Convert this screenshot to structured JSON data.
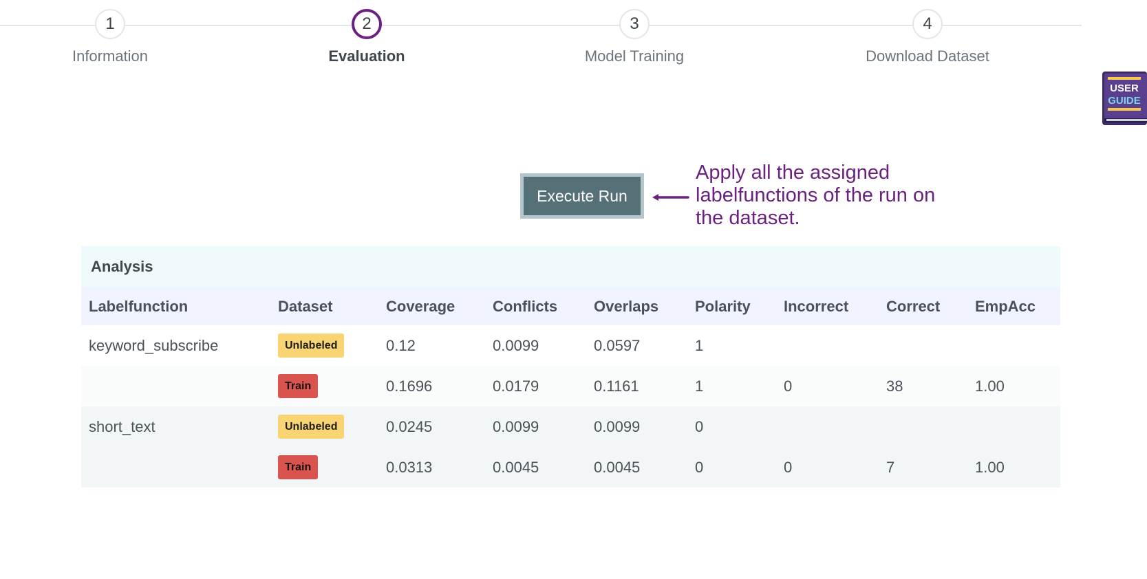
{
  "stepper": {
    "steps": [
      {
        "number": "1",
        "label": "Information"
      },
      {
        "number": "2",
        "label": "Evaluation"
      },
      {
        "number": "3",
        "label": "Model Training"
      },
      {
        "number": "4",
        "label": "Download Dataset"
      }
    ],
    "active_step": 2
  },
  "user_guide": {
    "line1": "USER",
    "line2": "GUIDE"
  },
  "execute": {
    "button_label": "Execute Run",
    "hint": "Apply all the assigned labelfunctions of the run on the dataset."
  },
  "analysis": {
    "title": "Analysis",
    "columns": [
      "Labelfunction",
      "Dataset",
      "Coverage",
      "Conflicts",
      "Overlaps",
      "Polarity",
      "Incorrect",
      "Correct",
      "EmpAcc"
    ],
    "rows": [
      {
        "labelfunction": "keyword_subscribe",
        "dataset": "Unlabeled",
        "coverage": "0.12",
        "conflicts": "0.0099",
        "overlaps": "0.0597",
        "polarity": "1",
        "incorrect": "",
        "correct": "",
        "empacc": ""
      },
      {
        "labelfunction": "",
        "dataset": "Train",
        "coverage": "0.1696",
        "conflicts": "0.0179",
        "overlaps": "0.1161",
        "polarity": "1",
        "incorrect": "0",
        "correct": "38",
        "empacc": "1.00"
      },
      {
        "labelfunction": "short_text",
        "dataset": "Unlabeled",
        "coverage": "0.0245",
        "conflicts": "0.0099",
        "overlaps": "0.0099",
        "polarity": "0",
        "incorrect": "",
        "correct": "",
        "empacc": ""
      },
      {
        "labelfunction": "",
        "dataset": "Train",
        "coverage": "0.0313",
        "conflicts": "0.0045",
        "overlaps": "0.0045",
        "polarity": "0",
        "incorrect": "0",
        "correct": "7",
        "empacc": "1.00"
      }
    ]
  },
  "colors": {
    "accent": "#6b2180",
    "button": "#557077",
    "unlabeled_badge": "#f9d472",
    "train_badge": "#d9534f"
  }
}
